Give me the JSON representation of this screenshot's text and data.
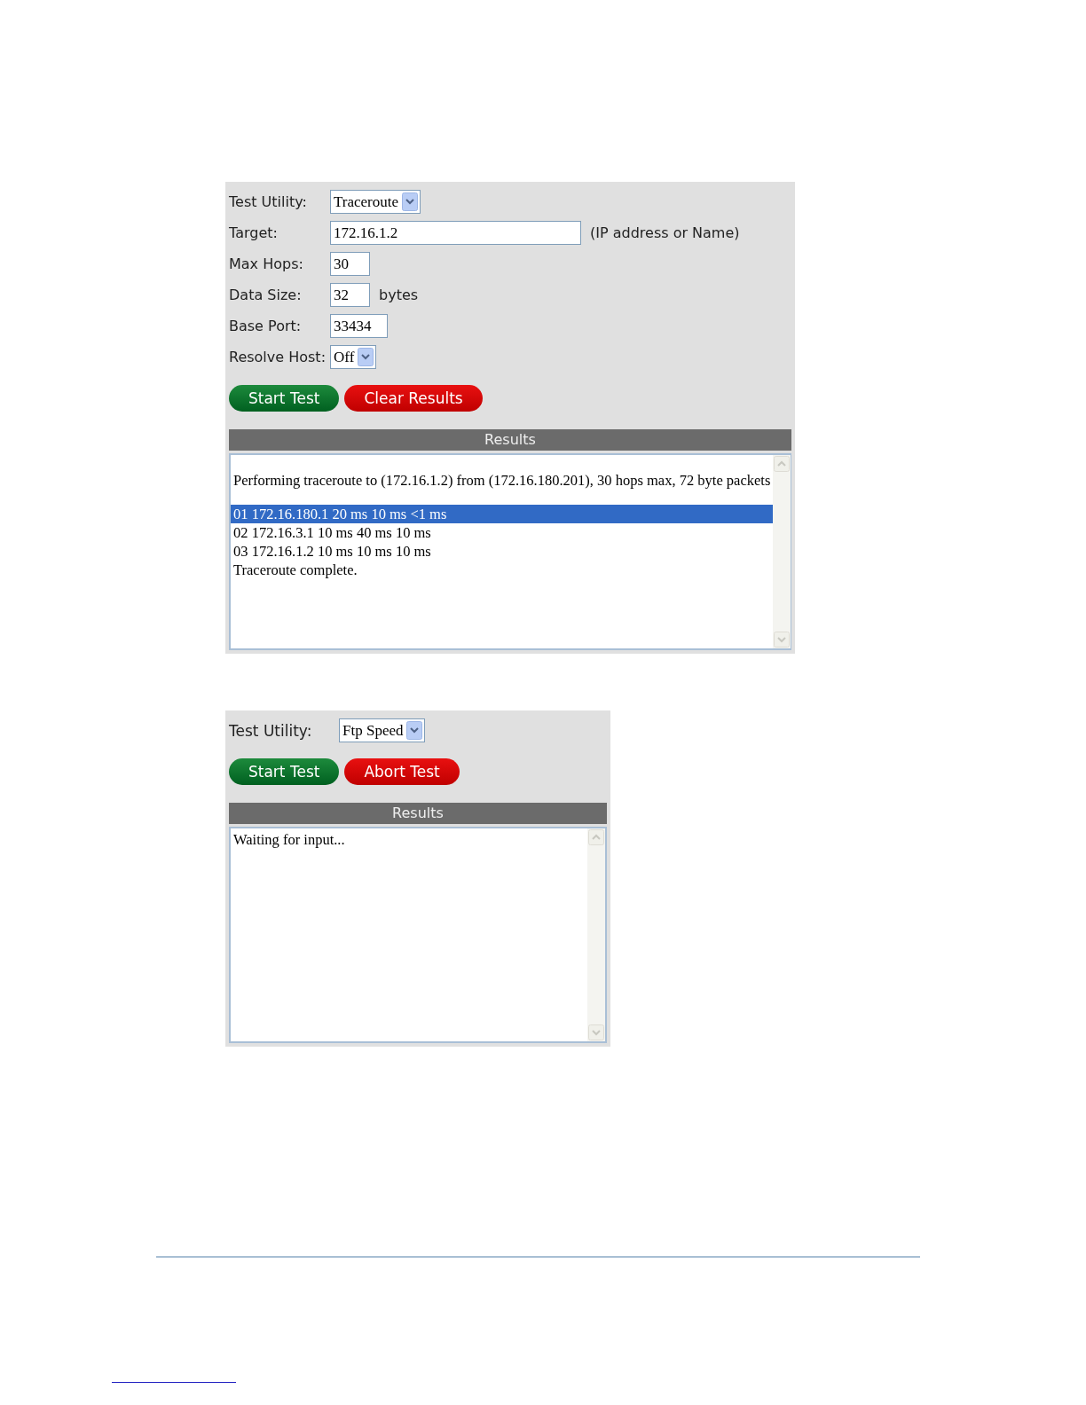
{
  "panels": [
    {
      "fields": [
        {
          "kind": "select",
          "label": "Test Utility:",
          "value": "Traceroute"
        },
        {
          "kind": "wide",
          "label": "Target:",
          "value": "172.16.1.2",
          "suffix": "(IP address or Name)"
        },
        {
          "kind": "text",
          "label": "Max Hops:",
          "value": "30"
        },
        {
          "kind": "text",
          "label": "Data Size:",
          "value": "32",
          "suffix": "bytes"
        },
        {
          "kind": "text",
          "label": "Base Port:",
          "value": "33434"
        },
        {
          "kind": "select",
          "label": "Resolve Host:",
          "value": "Off"
        }
      ],
      "buttons": [
        {
          "kind": "go",
          "label": "Start Test"
        },
        {
          "kind": "stop",
          "label": "Clear Results"
        }
      ],
      "results": {
        "title": "Results",
        "lines": [
          {
            "kind": "header",
            "text": "Performing traceroute to (172.16.1.2) from (172.16.180.201), 30 hops max, 72 byte packets",
            "selected": false
          },
          {
            "kind": "line",
            "text": "01 172.16.180.1 20 ms 10 ms <1 ms",
            "selected": true
          },
          {
            "kind": "line",
            "text": "02 172.16.3.1 10 ms 40 ms 10 ms",
            "selected": false
          },
          {
            "kind": "line",
            "text": "03 172.16.1.2 10 ms 10 ms 10 ms",
            "selected": false
          },
          {
            "kind": "line",
            "text": "Traceroute complete.",
            "selected": false
          }
        ]
      }
    },
    {
      "fields": [
        {
          "kind": "select",
          "label": "Test Utility:",
          "value": "Ftp Speed"
        }
      ],
      "buttons": [
        {
          "kind": "go",
          "label": "Start Test"
        },
        {
          "kind": "stop",
          "label": "Abort Test"
        }
      ],
      "results": {
        "title": "Results",
        "lines": [
          {
            "kind": "line",
            "text": "Waiting for input...",
            "selected": false
          }
        ]
      }
    }
  ]
}
